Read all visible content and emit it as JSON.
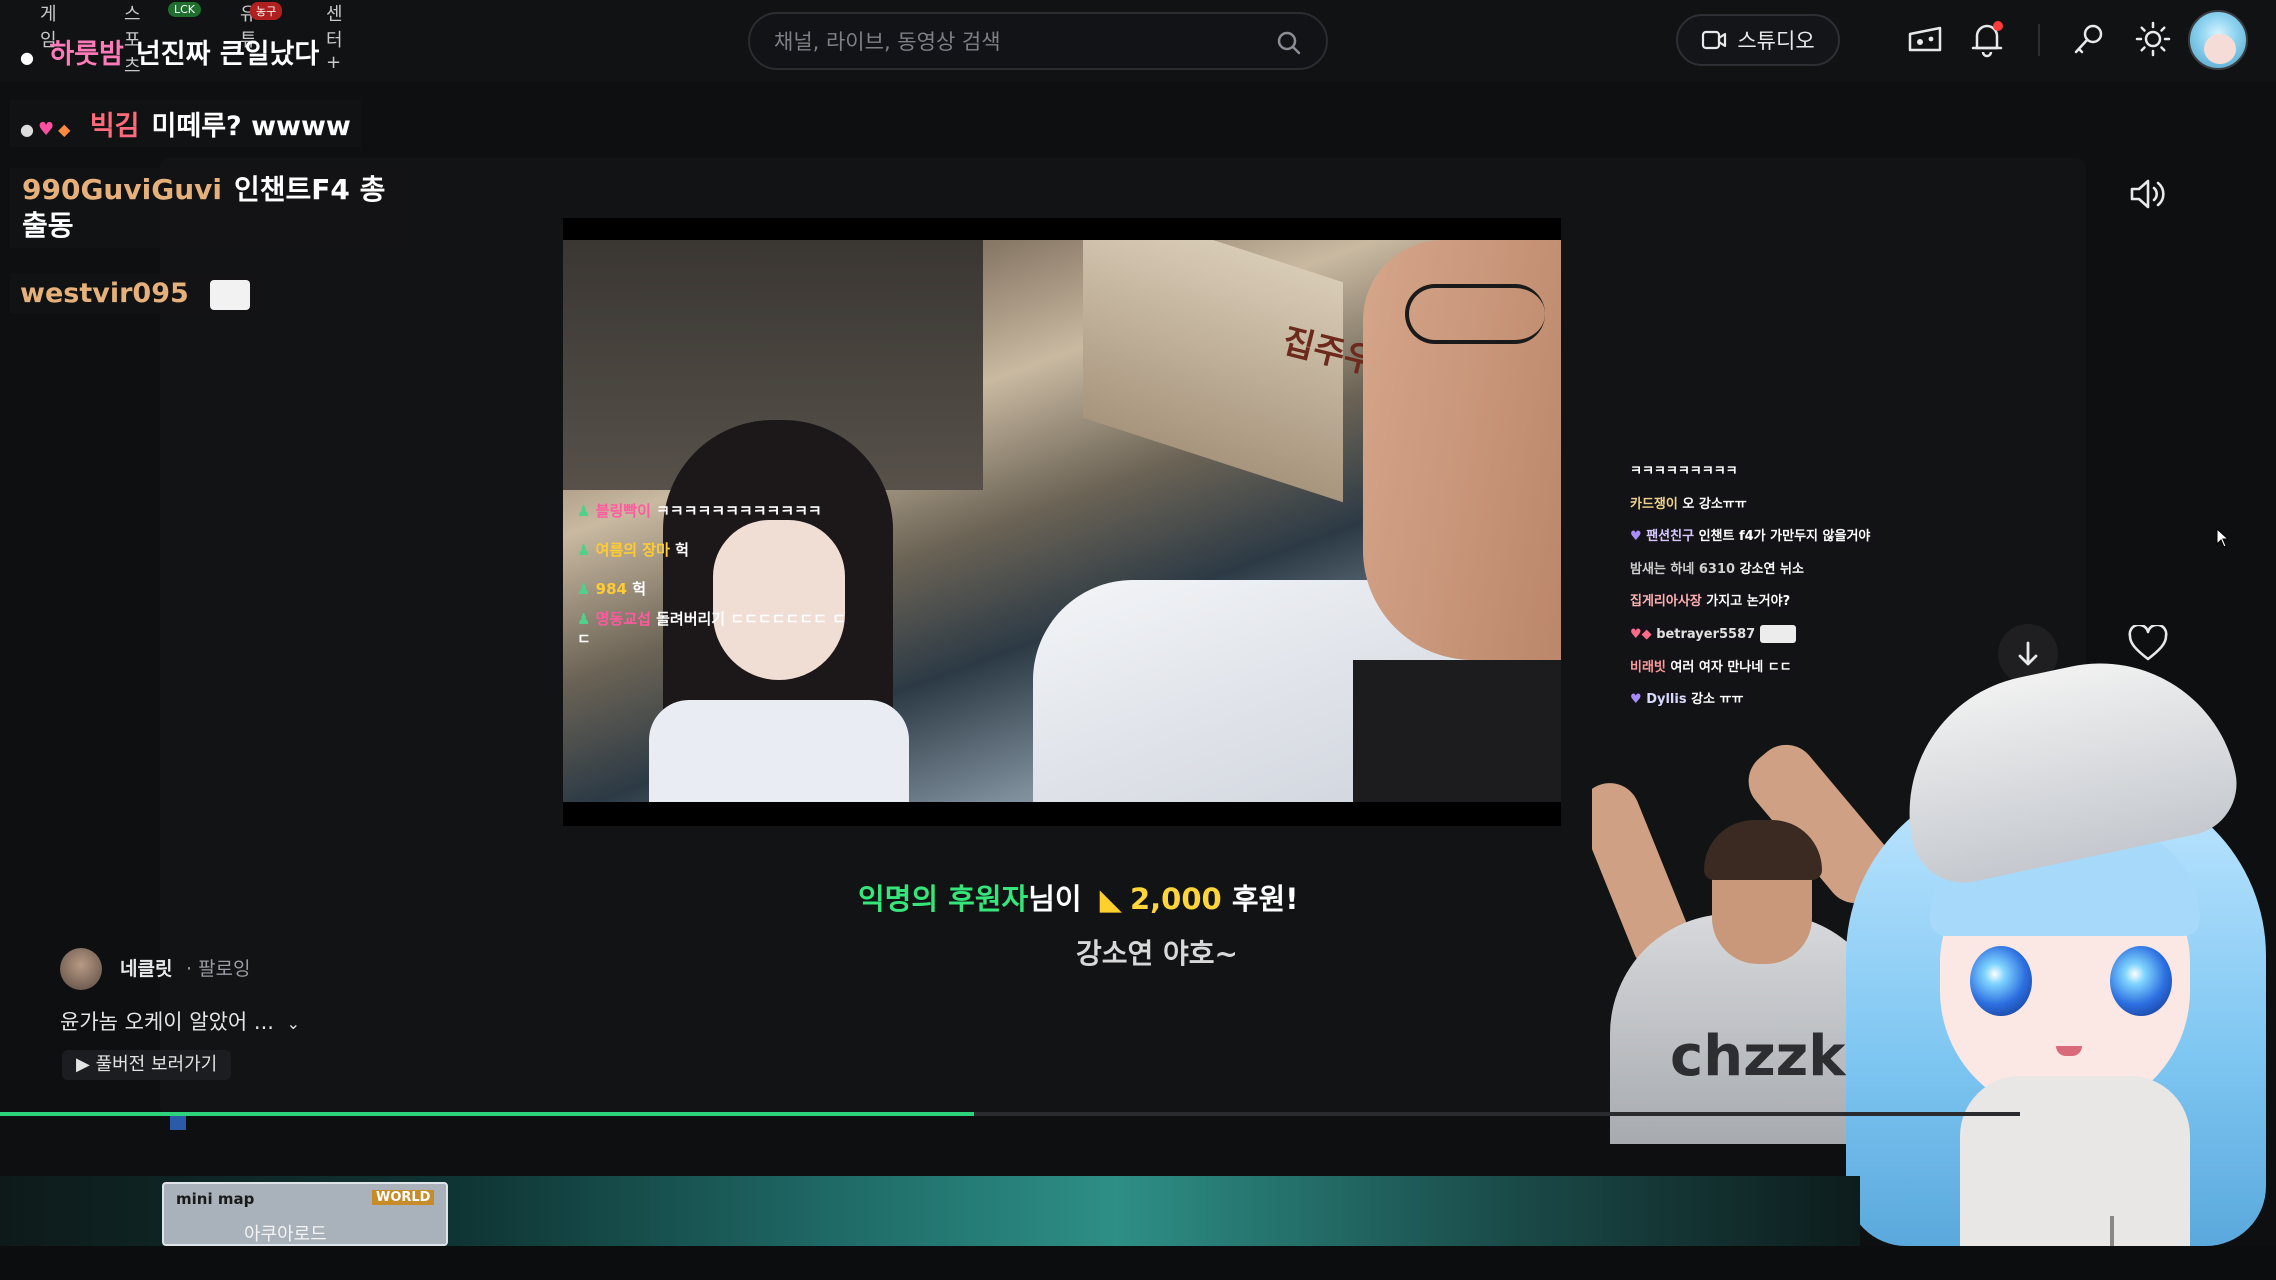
{
  "header": {
    "search_placeholder": "채널, 라이브, 동영상 검색",
    "studio_label": "스튜디오"
  },
  "overlay_chat": {
    "tabs": [
      "게임",
      "스포츠",
      "유튜",
      "센터+"
    ],
    "badges": [
      "LCK",
      "농구"
    ],
    "lines": [
      {
        "name": "하룻밤",
        "text": "넌진짜 큰일났다",
        "name_color": "#ff7ab8"
      },
      {
        "name": "빅김",
        "text": "미떼루? wwww",
        "name_color": "#ff6b7a"
      },
      {
        "name": "990GuviGuvi",
        "text": "인챈트F4 총출동",
        "name_color": "#e6b07a"
      },
      {
        "name": "westvir095",
        "text": "",
        "name_color": "#e6b07a"
      }
    ]
  },
  "video_chat": [
    {
      "name": "블링빡이",
      "text": "ㅋㅋㅋㅋㅋㅋㅋㅋㅋㅋㅋㅋ"
    },
    {
      "name": "여름의 장마",
      "text": "헉"
    },
    {
      "name": "984",
      "text": "헉"
    },
    {
      "name": "명동교섭",
      "text": "돌려버리기 ㄷㄷㄷㄷㄷㄷㄷ ㄷㄷ"
    }
  ],
  "donation": {
    "donor": "익명의 후원자",
    "suffix": "님이",
    "amount": "2,000",
    "label": "후원!",
    "message": "강소연 야호~"
  },
  "stream_chat": [
    {
      "name": "",
      "text": "ㅋㅋㅋㅋㅋㅋㅋㅋㅋ"
    },
    {
      "name": "카드쟁이",
      "text": "오 강소ㅠㅠ"
    },
    {
      "name": "팬션친구",
      "text": "인챈트 f4가 가만두지 않을거야"
    },
    {
      "name": "밤새는 하네 6310",
      "text": "강소연 뉘소"
    },
    {
      "name": "집게리아사장",
      "text": "가지고 논거야?"
    },
    {
      "name": "betrayer5587",
      "text": ""
    },
    {
      "name": "비래빗",
      "text": "여러 여자 만나네 ㄷㄷ"
    },
    {
      "name": "Dyllis",
      "text": "강소 ㅠㅠ"
    }
  ],
  "streamer_shirt": "chzzk",
  "channel": {
    "name": "네클릿",
    "follow": "· 팔로잉",
    "title": "윤가놈 오케이 알았어 ...",
    "full_button": "▶ 풀버전 보러가기"
  },
  "progress": {
    "fraction": 0.482
  },
  "minimap": {
    "title": "mini map",
    "world": "WORLD",
    "name": "아쿠아로드"
  },
  "colors": {
    "accent": "#2dd37a",
    "donation_green": "#35e67a",
    "donation_yellow": "#ffd53b"
  }
}
